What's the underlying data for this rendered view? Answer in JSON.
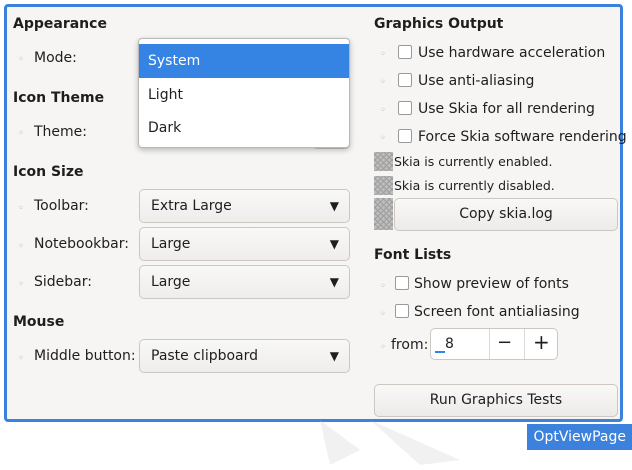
{
  "left": {
    "appearance": {
      "heading": "Appearance",
      "mode_label": "Mode:",
      "mode_options": [
        "System",
        "Light",
        "Dark"
      ],
      "selected": "System"
    },
    "icon_theme": {
      "heading": "Icon Theme",
      "theme_label": "Theme:"
    },
    "icon_size": {
      "heading": "Icon Size",
      "toolbar_label": "Toolbar:",
      "toolbar_value": "Extra Large",
      "notebookbar_label": "Notebookbar:",
      "notebookbar_value": "Large",
      "sidebar_label": "Sidebar:",
      "sidebar_value": "Large"
    },
    "mouse": {
      "heading": "Mouse",
      "middle_label": "Middle button:",
      "middle_value": "Paste clipboard"
    }
  },
  "right": {
    "graphics": {
      "heading": "Graphics Output",
      "hw": "Use hardware acceleration",
      "aa": "Use anti-aliasing",
      "skia_all": "Use Skia for all rendering",
      "skia_sw": "Force Skia software rendering",
      "skia_enabled": "Skia is currently enabled.",
      "skia_disabled": "Skia is currently disabled.",
      "copy_log": "Copy skia.log"
    },
    "fonts": {
      "heading": "Font Lists",
      "preview": "Show preview of fonts",
      "antialias": "Screen font antialiasing",
      "from_label": "from:",
      "from_value": "8"
    },
    "run_tests": "Run Graphics Tests"
  },
  "page_tag": "OptViewPage"
}
